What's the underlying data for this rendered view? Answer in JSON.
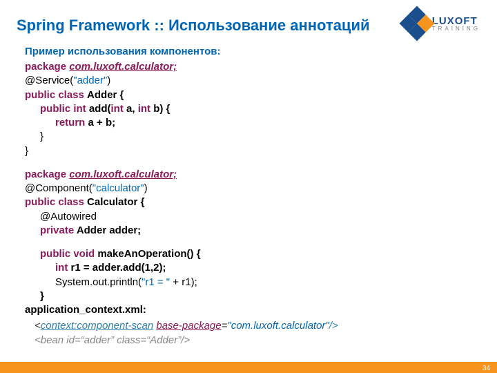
{
  "header": {
    "title": "Spring Framework :: Использование аннотаций",
    "logo": {
      "brand": "LUXOFT",
      "sub": "TRAINING"
    }
  },
  "subtitle": "Пример использования компонентов:",
  "code1": {
    "pkg_kw": "package",
    "pkg": "com.luxoft.calculator;",
    "ann": "@Service(",
    "ann_val": "\"adder\"",
    "ann_close": ")",
    "pub_class": "public class",
    "cls": "Adder",
    "brace": " {",
    "pub_int": "public int",
    "method": " add(",
    "int1": "int",
    "a": " a, ",
    "int2": "int",
    "b": " b) {",
    "ret": "return",
    "ret_expr": " a + b;",
    "cb1": "}",
    "cb2": "}"
  },
  "code2": {
    "pkg_kw": "package",
    "pkg": "com.luxoft.calculator;",
    "ann": "@Component(",
    "ann_val": "\"calculator\"",
    "ann_close": ")",
    "pub_class": "public class",
    "cls": "Calculator",
    "brace": " {",
    "autowired": "@Autowired",
    "priv": "private",
    "adder_decl": " Adder adder;",
    "pub_void": "public void",
    "method": " makeAnOperation() {",
    "int_kw": "int",
    "r1_line": " r1 = adder.add(1,2);",
    "println_pre": "System.out.println(",
    "println_str": "\"r1 = \"",
    "println_post": " + r1);",
    "cb": "}"
  },
  "xml_label": "application_context.xml:",
  "xml1": {
    "lt": "<",
    "tag": "context:component-scan",
    "sp": " ",
    "attr": "base-package",
    "eq": "=",
    "val": "\"com.luxoft.calculator\"",
    "end": "/>"
  },
  "xml2": {
    "raw": "<bean id=“adder” class=“Adder”/>"
  },
  "page": "34"
}
